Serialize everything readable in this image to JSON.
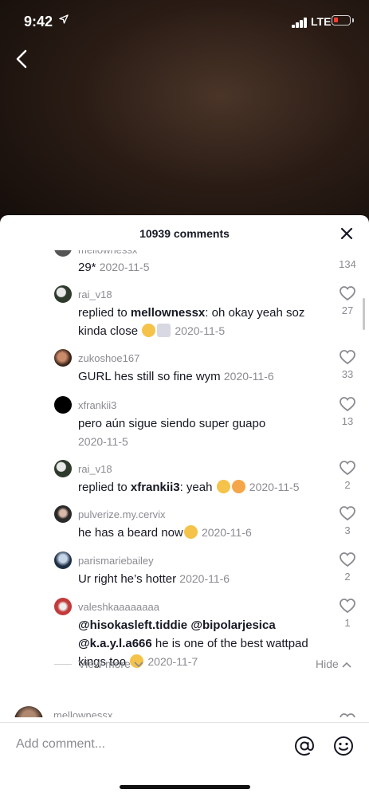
{
  "status_bar": {
    "time": "9:42",
    "network": "LTE"
  },
  "header": {
    "comments_count": "10939 comments"
  },
  "comments": [
    {
      "username": "mellownessx",
      "text": "29*",
      "date": "2020-11-5",
      "likes": "134"
    },
    {
      "username": "rai_v18",
      "reply_prefix": "replied to ",
      "reply_to": "mellownessx",
      "text": ": oh okay yeah soz kinda close",
      "date": "2020-11-5",
      "likes": "27"
    },
    {
      "username": "zukoshoe167",
      "text": "GURL hes still so fine wym",
      "date": "2020-11-6",
      "likes": "33"
    },
    {
      "username": "xfrankii3",
      "text": "pero aún sigue siendo super guapo",
      "date": "2020-11-5",
      "likes": "13"
    },
    {
      "username": "rai_v18",
      "reply_prefix": "replied to ",
      "reply_to": "xfrankii3",
      "text": ": yeah",
      "date": "2020-11-5",
      "likes": "2"
    },
    {
      "username": "pulverize.my.cervix",
      "text": "he has a beard now",
      "date": "2020-11-6",
      "likes": "3"
    },
    {
      "username": "parismariebailey",
      "text": "Ur right he’s hotter",
      "date": "2020-11-6",
      "likes": "2"
    },
    {
      "username": "valeshkaaaaaaaa",
      "mentions": [
        "@hisokasleft.tiddie",
        "@bipolarjesica",
        "@k.a.y.l.a666"
      ],
      "text": " he is one of the best wattpad kings too",
      "date": "2020-11-7",
      "likes": "1"
    },
    {
      "username": "mellownessx"
    }
  ],
  "view_more": {
    "label": "View more",
    "hide_label": "Hide"
  },
  "input": {
    "placeholder": "Add comment..."
  },
  "colors": {
    "heart_outline": "#8a8b91",
    "text": "#161823",
    "secondary": "#8a8b91",
    "battery_low": "#ff3b30"
  }
}
